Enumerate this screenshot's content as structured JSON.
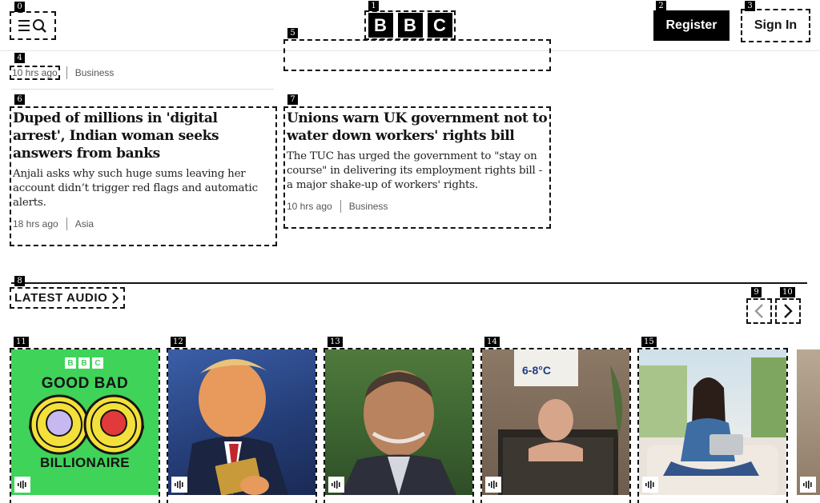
{
  "header": {
    "register_label": "Register",
    "signin_label": "Sign In",
    "logo_letters": [
      "B",
      "B",
      "C"
    ]
  },
  "top_meta": {
    "time": "10 hrs ago",
    "category": "Business"
  },
  "articles": [
    {
      "title": "Duped of millions in 'digital arrest', Indian woman seeks answers from banks",
      "summary": "Anjali asks why such huge sums leaving her account didn’t trigger red flags and automatic alerts.",
      "time": "18 hrs ago",
      "category": "Asia"
    },
    {
      "title": "Unions warn UK government not to water down workers' rights bill",
      "summary": "The TUC has urged the government to \"stay on course\" in delivering its employment rights bill - a major shake-up of workers' rights.",
      "time": "10 hrs ago",
      "category": "Business"
    }
  ],
  "latest_audio": {
    "title": "LATEST AUDIO",
    "tiles": [
      {
        "image": "good-bad-billionaire-podcast-art",
        "logo_letters": [
          "B",
          "B",
          "C"
        ],
        "line1": "GOOD BAD",
        "line2": "BILLIONAIRE"
      },
      {
        "image": "man-holding-gold-card"
      },
      {
        "image": "smiling-man-portrait"
      },
      {
        "image": "man-in-ice-bath",
        "sign_text": "6-8°C"
      },
      {
        "image": "woman-with-laptop-on-sofa"
      }
    ]
  },
  "badges": [
    "0",
    "1",
    "2",
    "3",
    "4",
    "5",
    "6",
    "7",
    "8",
    "9",
    "10",
    "11",
    "12",
    "13",
    "14",
    "15"
  ],
  "colors": {
    "accent": "#000000",
    "podcast_green": "#3fd35a",
    "podcast_yellow": "#f3e03a"
  }
}
